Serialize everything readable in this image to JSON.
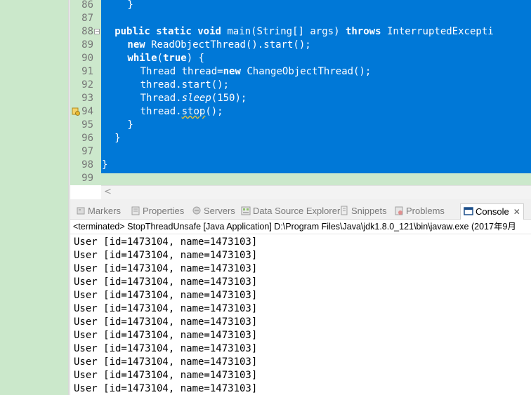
{
  "editor": {
    "line_numbers": [
      "86",
      "87",
      "88",
      "89",
      "90",
      "91",
      "92",
      "93",
      "94",
      "95",
      "96",
      "97",
      "98",
      "99"
    ],
    "code_lines": [
      {
        "indent": "        ",
        "segments": [
          {
            "t": "}",
            "c": ""
          }
        ]
      },
      {
        "indent": "",
        "segments": []
      },
      {
        "indent": "    ",
        "segments": [
          {
            "t": "public",
            "c": "kw"
          },
          {
            "t": " ",
            "c": ""
          },
          {
            "t": "static",
            "c": "kw"
          },
          {
            "t": " ",
            "c": ""
          },
          {
            "t": "void",
            "c": "kw"
          },
          {
            "t": " main(String[] args) ",
            "c": ""
          },
          {
            "t": "throws",
            "c": "kw"
          },
          {
            "t": " InterruptedExcepti",
            "c": ""
          }
        ]
      },
      {
        "indent": "        ",
        "segments": [
          {
            "t": "new",
            "c": "kw"
          },
          {
            "t": " ReadObjectThread().start();",
            "c": ""
          }
        ]
      },
      {
        "indent": "        ",
        "segments": [
          {
            "t": "while",
            "c": "kw"
          },
          {
            "t": "(",
            "c": ""
          },
          {
            "t": "true",
            "c": "kw"
          },
          {
            "t": ") {",
            "c": ""
          }
        ]
      },
      {
        "indent": "            ",
        "segments": [
          {
            "t": "Thread thread=",
            "c": ""
          },
          {
            "t": "new",
            "c": "kw"
          },
          {
            "t": " ChangeObjectThread();",
            "c": ""
          }
        ]
      },
      {
        "indent": "            ",
        "segments": [
          {
            "t": "thread.start();",
            "c": ""
          }
        ]
      },
      {
        "indent": "            ",
        "segments": [
          {
            "t": "Thread.",
            "c": ""
          },
          {
            "t": "sleep",
            "c": "it"
          },
          {
            "t": "(150);",
            "c": ""
          }
        ]
      },
      {
        "indent": "            ",
        "segments": [
          {
            "t": "thread.",
            "c": ""
          },
          {
            "t": "stop",
            "c": "squig"
          },
          {
            "t": "();",
            "c": ""
          }
        ]
      },
      {
        "indent": "        ",
        "segments": [
          {
            "t": "}",
            "c": ""
          }
        ]
      },
      {
        "indent": "    ",
        "segments": [
          {
            "t": "}",
            "c": ""
          }
        ]
      },
      {
        "indent": "",
        "segments": []
      },
      {
        "indent": "",
        "segments": [
          {
            "t": "}",
            "c": ""
          }
        ]
      },
      {
        "indent": "",
        "segments": []
      }
    ],
    "fold_marker": "−",
    "scroll_left_arrow": "<"
  },
  "tabs": [
    {
      "label": "Markers",
      "icon": "markers-icon"
    },
    {
      "label": "Properties",
      "icon": "properties-icon"
    },
    {
      "label": "Servers",
      "icon": "servers-icon"
    },
    {
      "label": "Data Source Explorer",
      "icon": "data-source-icon"
    },
    {
      "label": "Snippets",
      "icon": "snippets-icon"
    },
    {
      "label": "Problems",
      "icon": "problems-icon"
    },
    {
      "label": "Console",
      "icon": "console-icon",
      "active": true
    }
  ],
  "tab_close": "✕",
  "console": {
    "header": "<terminated> StopThreadUnsafe [Java Application] D:\\Program Files\\Java\\jdk1.8.0_121\\bin\\javaw.exe (2017年9月",
    "output_lines": [
      "User [id=1473104, name=1473103]",
      "User [id=1473104, name=1473103]",
      "User [id=1473104, name=1473103]",
      "User [id=1473104, name=1473103]",
      "User [id=1473104, name=1473103]",
      "User [id=1473104, name=1473103]",
      "User [id=1473104, name=1473103]",
      "User [id=1473104, name=1473103]",
      "User [id=1473104, name=1473103]",
      "User [id=1473104, name=1473103]",
      "User [id=1473104, name=1473103]",
      "User [id=1473104, name=1473103]"
    ]
  },
  "colors": {
    "selection": "#0078d7",
    "editor_background": "#cbe8cb",
    "warning_marker": "#e8b830"
  }
}
